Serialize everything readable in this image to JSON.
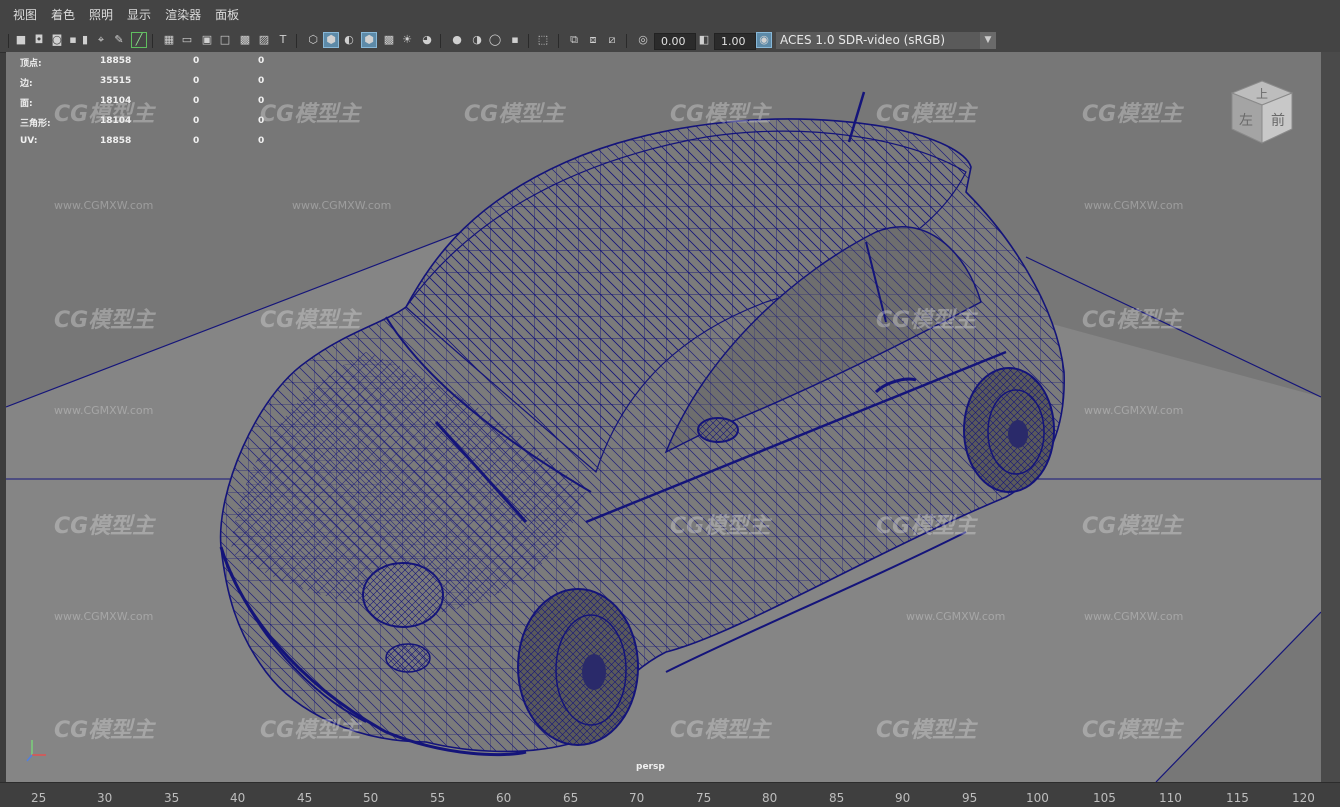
{
  "menu": [
    "视图",
    "着色",
    "照明",
    "显示",
    "渲染器",
    "面板"
  ],
  "toolbar": {
    "exposure_value": "0.00",
    "gamma_value": "1.00",
    "color_management": "ACES 1.0 SDR-video (sRGB)"
  },
  "hud": {
    "rows": [
      {
        "label": "顶点:",
        "total": "18858",
        "selected": "0",
        "third": "0"
      },
      {
        "label": "边:",
        "total": "35515",
        "selected": "0",
        "third": "0"
      },
      {
        "label": "面:",
        "total": "18104",
        "selected": "0",
        "third": "0"
      },
      {
        "label": "三角形:",
        "total": "18104",
        "selected": "0",
        "third": "0"
      },
      {
        "label": "UV:",
        "total": "18858",
        "selected": "0",
        "third": "0"
      }
    ]
  },
  "viewcube": {
    "top": "上",
    "left": "左",
    "front": "前"
  },
  "camera_label": "persp",
  "watermark": {
    "logo": "CG模型主",
    "url": "www.CGMXW.com"
  },
  "timeline": {
    "ticks": [
      "25",
      "30",
      "35",
      "40",
      "45",
      "50",
      "55",
      "60",
      "65",
      "70",
      "75",
      "80",
      "85",
      "90",
      "95",
      "100",
      "105",
      "110",
      "115",
      "120"
    ]
  },
  "colors": {
    "wireframe": "#14147a",
    "viewport_bg": "#777777",
    "ui_bg": "#444444",
    "highlight": "#5d8aa8"
  }
}
